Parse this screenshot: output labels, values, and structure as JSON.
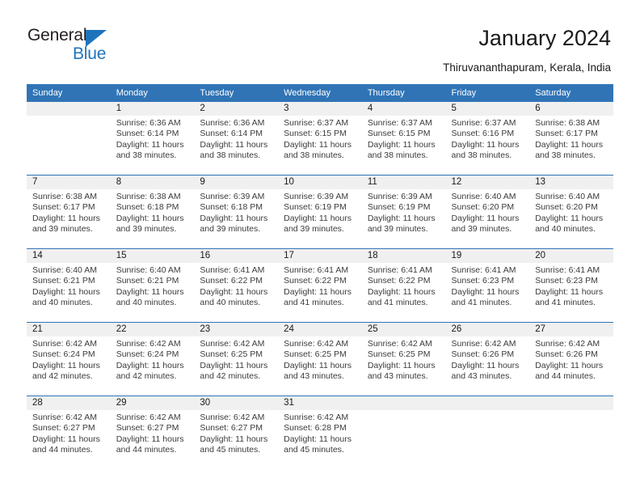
{
  "brand": {
    "name_part1": "General",
    "name_part2": "Blue",
    "triangle_color": "#1e74bb"
  },
  "header": {
    "title": "January 2024",
    "subtitle": "Thiruvananthapuram, Kerala, India",
    "accent_color": "#3074b6",
    "daynum_bg": "#f0f0f0"
  },
  "calendar": {
    "weekday_headers": [
      "Sunday",
      "Monday",
      "Tuesday",
      "Wednesday",
      "Thursday",
      "Friday",
      "Saturday"
    ],
    "weeks": [
      [
        {
          "day": "",
          "sunrise": "",
          "sunset": "",
          "daylight": ""
        },
        {
          "day": "1",
          "sunrise": "Sunrise: 6:36 AM",
          "sunset": "Sunset: 6:14 PM",
          "daylight": "Daylight: 11 hours and 38 minutes."
        },
        {
          "day": "2",
          "sunrise": "Sunrise: 6:36 AM",
          "sunset": "Sunset: 6:14 PM",
          "daylight": "Daylight: 11 hours and 38 minutes."
        },
        {
          "day": "3",
          "sunrise": "Sunrise: 6:37 AM",
          "sunset": "Sunset: 6:15 PM",
          "daylight": "Daylight: 11 hours and 38 minutes."
        },
        {
          "day": "4",
          "sunrise": "Sunrise: 6:37 AM",
          "sunset": "Sunset: 6:15 PM",
          "daylight": "Daylight: 11 hours and 38 minutes."
        },
        {
          "day": "5",
          "sunrise": "Sunrise: 6:37 AM",
          "sunset": "Sunset: 6:16 PM",
          "daylight": "Daylight: 11 hours and 38 minutes."
        },
        {
          "day": "6",
          "sunrise": "Sunrise: 6:38 AM",
          "sunset": "Sunset: 6:17 PM",
          "daylight": "Daylight: 11 hours and 38 minutes."
        }
      ],
      [
        {
          "day": "7",
          "sunrise": "Sunrise: 6:38 AM",
          "sunset": "Sunset: 6:17 PM",
          "daylight": "Daylight: 11 hours and 39 minutes."
        },
        {
          "day": "8",
          "sunrise": "Sunrise: 6:38 AM",
          "sunset": "Sunset: 6:18 PM",
          "daylight": "Daylight: 11 hours and 39 minutes."
        },
        {
          "day": "9",
          "sunrise": "Sunrise: 6:39 AM",
          "sunset": "Sunset: 6:18 PM",
          "daylight": "Daylight: 11 hours and 39 minutes."
        },
        {
          "day": "10",
          "sunrise": "Sunrise: 6:39 AM",
          "sunset": "Sunset: 6:19 PM",
          "daylight": "Daylight: 11 hours and 39 minutes."
        },
        {
          "day": "11",
          "sunrise": "Sunrise: 6:39 AM",
          "sunset": "Sunset: 6:19 PM",
          "daylight": "Daylight: 11 hours and 39 minutes."
        },
        {
          "day": "12",
          "sunrise": "Sunrise: 6:40 AM",
          "sunset": "Sunset: 6:20 PM",
          "daylight": "Daylight: 11 hours and 39 minutes."
        },
        {
          "day": "13",
          "sunrise": "Sunrise: 6:40 AM",
          "sunset": "Sunset: 6:20 PM",
          "daylight": "Daylight: 11 hours and 40 minutes."
        }
      ],
      [
        {
          "day": "14",
          "sunrise": "Sunrise: 6:40 AM",
          "sunset": "Sunset: 6:21 PM",
          "daylight": "Daylight: 11 hours and 40 minutes."
        },
        {
          "day": "15",
          "sunrise": "Sunrise: 6:40 AM",
          "sunset": "Sunset: 6:21 PM",
          "daylight": "Daylight: 11 hours and 40 minutes."
        },
        {
          "day": "16",
          "sunrise": "Sunrise: 6:41 AM",
          "sunset": "Sunset: 6:22 PM",
          "daylight": "Daylight: 11 hours and 40 minutes."
        },
        {
          "day": "17",
          "sunrise": "Sunrise: 6:41 AM",
          "sunset": "Sunset: 6:22 PM",
          "daylight": "Daylight: 11 hours and 41 minutes."
        },
        {
          "day": "18",
          "sunrise": "Sunrise: 6:41 AM",
          "sunset": "Sunset: 6:22 PM",
          "daylight": "Daylight: 11 hours and 41 minutes."
        },
        {
          "day": "19",
          "sunrise": "Sunrise: 6:41 AM",
          "sunset": "Sunset: 6:23 PM",
          "daylight": "Daylight: 11 hours and 41 minutes."
        },
        {
          "day": "20",
          "sunrise": "Sunrise: 6:41 AM",
          "sunset": "Sunset: 6:23 PM",
          "daylight": "Daylight: 11 hours and 41 minutes."
        }
      ],
      [
        {
          "day": "21",
          "sunrise": "Sunrise: 6:42 AM",
          "sunset": "Sunset: 6:24 PM",
          "daylight": "Daylight: 11 hours and 42 minutes."
        },
        {
          "day": "22",
          "sunrise": "Sunrise: 6:42 AM",
          "sunset": "Sunset: 6:24 PM",
          "daylight": "Daylight: 11 hours and 42 minutes."
        },
        {
          "day": "23",
          "sunrise": "Sunrise: 6:42 AM",
          "sunset": "Sunset: 6:25 PM",
          "daylight": "Daylight: 11 hours and 42 minutes."
        },
        {
          "day": "24",
          "sunrise": "Sunrise: 6:42 AM",
          "sunset": "Sunset: 6:25 PM",
          "daylight": "Daylight: 11 hours and 43 minutes."
        },
        {
          "day": "25",
          "sunrise": "Sunrise: 6:42 AM",
          "sunset": "Sunset: 6:25 PM",
          "daylight": "Daylight: 11 hours and 43 minutes."
        },
        {
          "day": "26",
          "sunrise": "Sunrise: 6:42 AM",
          "sunset": "Sunset: 6:26 PM",
          "daylight": "Daylight: 11 hours and 43 minutes."
        },
        {
          "day": "27",
          "sunrise": "Sunrise: 6:42 AM",
          "sunset": "Sunset: 6:26 PM",
          "daylight": "Daylight: 11 hours and 44 minutes."
        }
      ],
      [
        {
          "day": "28",
          "sunrise": "Sunrise: 6:42 AM",
          "sunset": "Sunset: 6:27 PM",
          "daylight": "Daylight: 11 hours and 44 minutes."
        },
        {
          "day": "29",
          "sunrise": "Sunrise: 6:42 AM",
          "sunset": "Sunset: 6:27 PM",
          "daylight": "Daylight: 11 hours and 44 minutes."
        },
        {
          "day": "30",
          "sunrise": "Sunrise: 6:42 AM",
          "sunset": "Sunset: 6:27 PM",
          "daylight": "Daylight: 11 hours and 45 minutes."
        },
        {
          "day": "31",
          "sunrise": "Sunrise: 6:42 AM",
          "sunset": "Sunset: 6:28 PM",
          "daylight": "Daylight: 11 hours and 45 minutes."
        },
        {
          "day": "",
          "sunrise": "",
          "sunset": "",
          "daylight": ""
        },
        {
          "day": "",
          "sunrise": "",
          "sunset": "",
          "daylight": ""
        },
        {
          "day": "",
          "sunrise": "",
          "sunset": "",
          "daylight": ""
        }
      ]
    ]
  }
}
